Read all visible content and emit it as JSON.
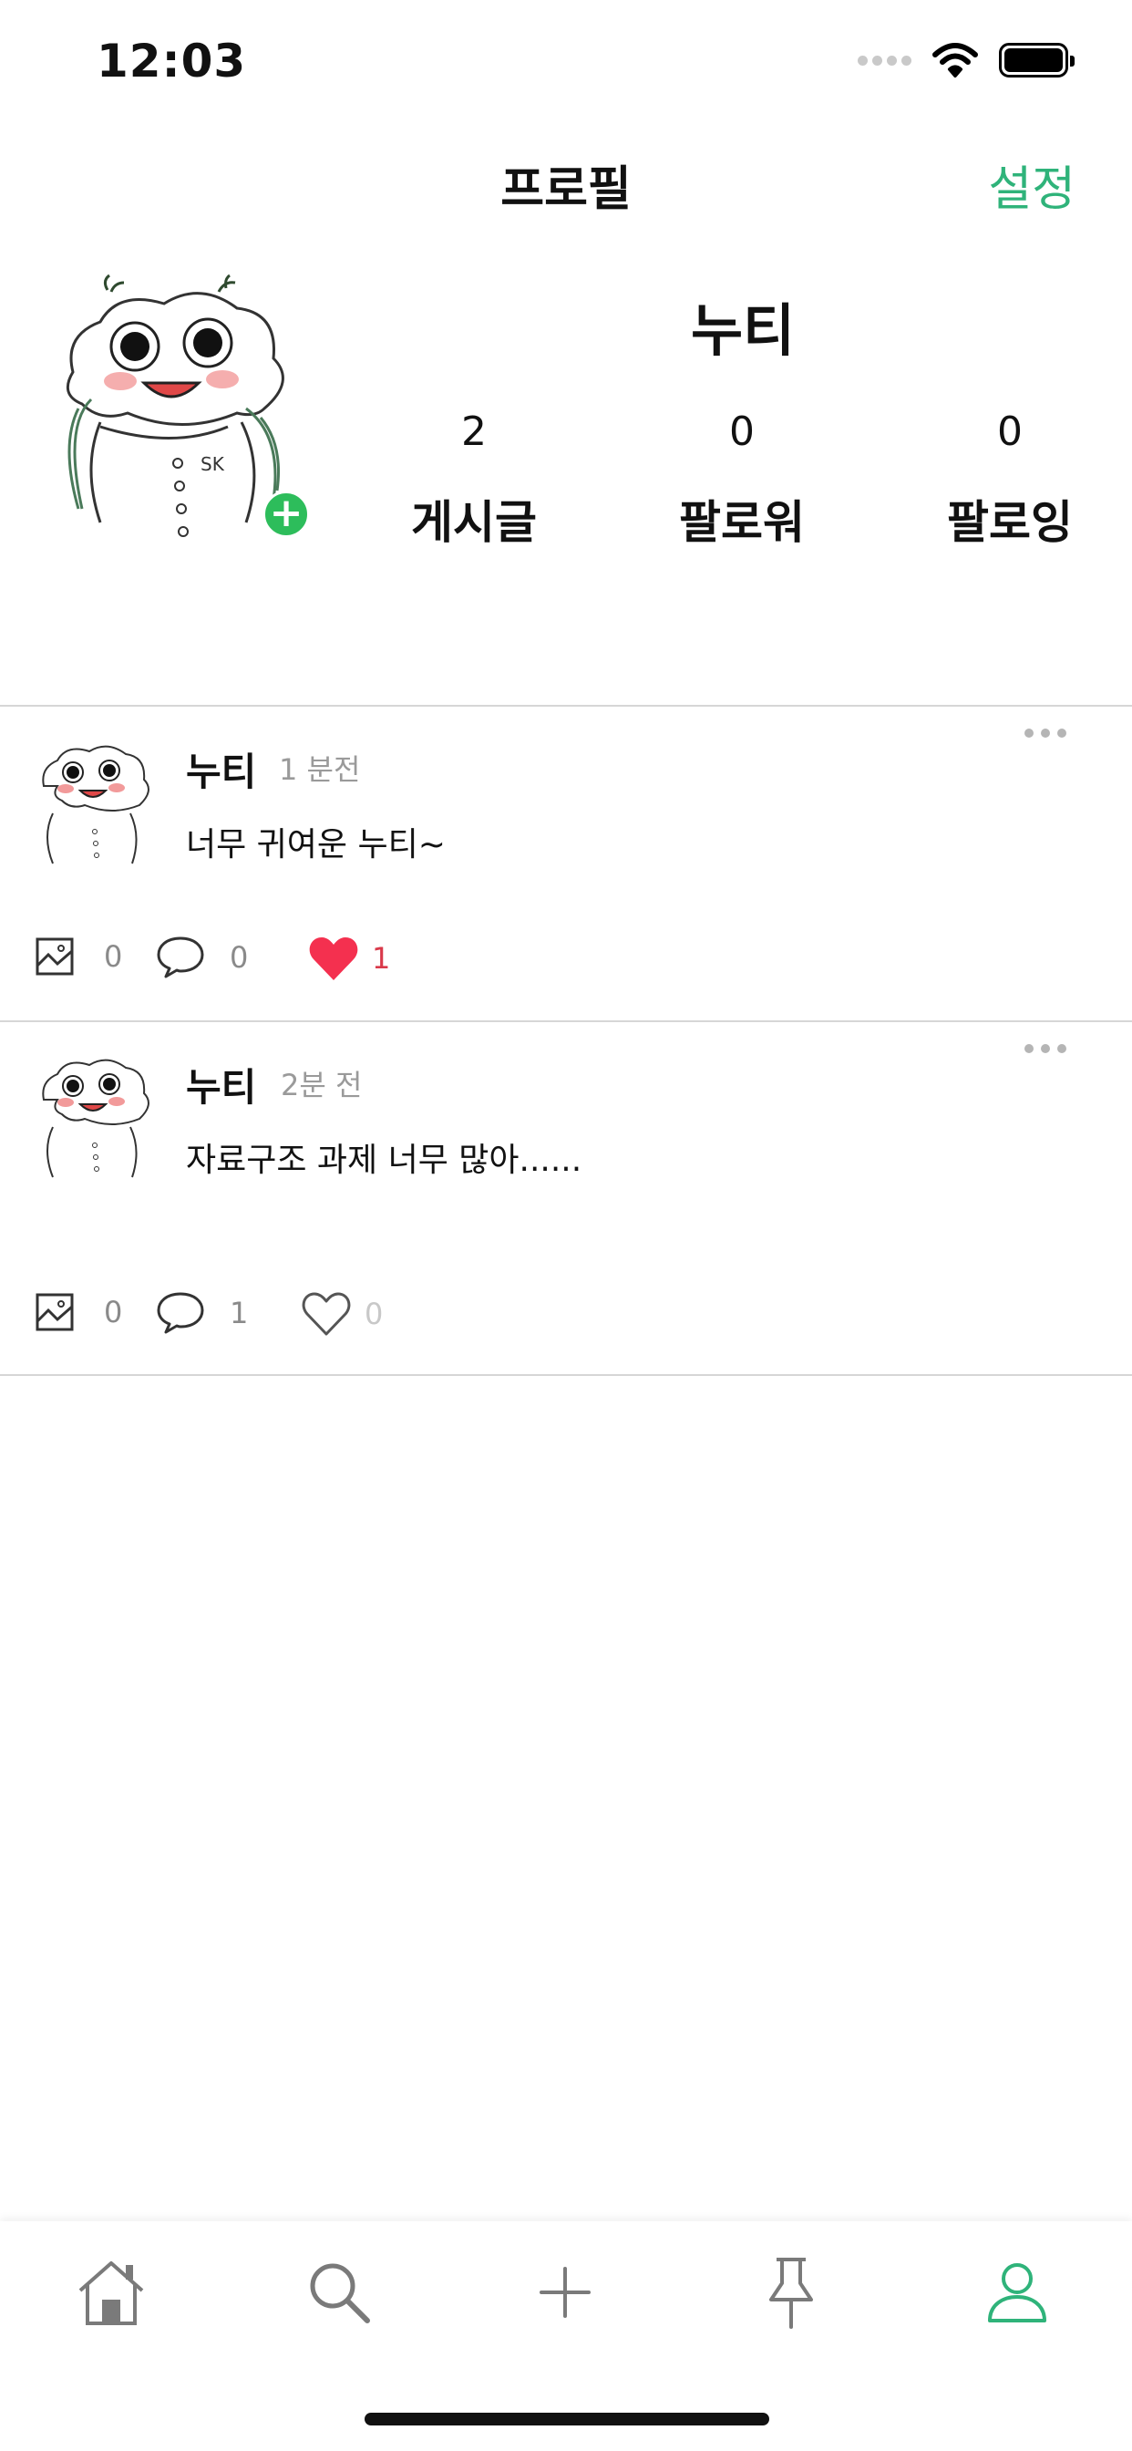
{
  "status_bar": {
    "time": "12:03"
  },
  "nav": {
    "title": "프로필",
    "settings_label": "설정"
  },
  "profile": {
    "name": "누티",
    "stats": [
      {
        "count": "2",
        "label": "게시글"
      },
      {
        "count": "0",
        "label": "팔로워"
      },
      {
        "count": "0",
        "label": "팔로잉"
      }
    ]
  },
  "posts": [
    {
      "author": "누티",
      "time": "1 분전",
      "text": "너무 귀여운 누티~",
      "images": "0",
      "comments": "0",
      "likes": "1",
      "liked": true
    },
    {
      "author": "누티",
      "time": "2분 전",
      "text": "자료구조 과제 너무 많아......",
      "images": "0",
      "comments": "1",
      "likes": "0",
      "liked": false
    }
  ],
  "tabbar": {
    "icons": [
      "home-icon",
      "search-icon",
      "plus-icon",
      "pin-icon",
      "person-icon"
    ],
    "active_index": 4
  },
  "colors": {
    "accent": "#2fb37a",
    "like": "#f4304f",
    "add_badge": "#2dbd5b"
  }
}
